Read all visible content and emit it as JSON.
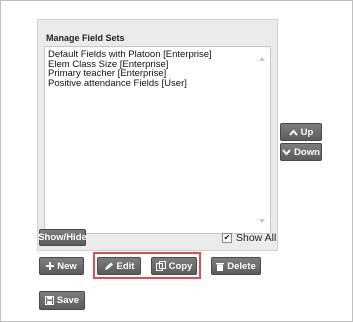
{
  "panel": {
    "title": "Manage Field Sets",
    "items": [
      "Default Fields with Platoon [Enterprise]",
      "Elem Class Size [Enterprise]",
      "Primary teacher [Enterprise]",
      "Positive attendance Fields [User]"
    ]
  },
  "side_buttons": {
    "up": "Up",
    "down": "Down"
  },
  "toolbar": {
    "show_hide": "Show/Hide",
    "show_all": "Show All",
    "show_all_checked": true,
    "new": "New",
    "edit": "Edit",
    "copy": "Copy",
    "delete": "Delete",
    "save": "Save"
  },
  "colors": {
    "button": "#6b6b6b",
    "highlight": "#e74c4c"
  }
}
